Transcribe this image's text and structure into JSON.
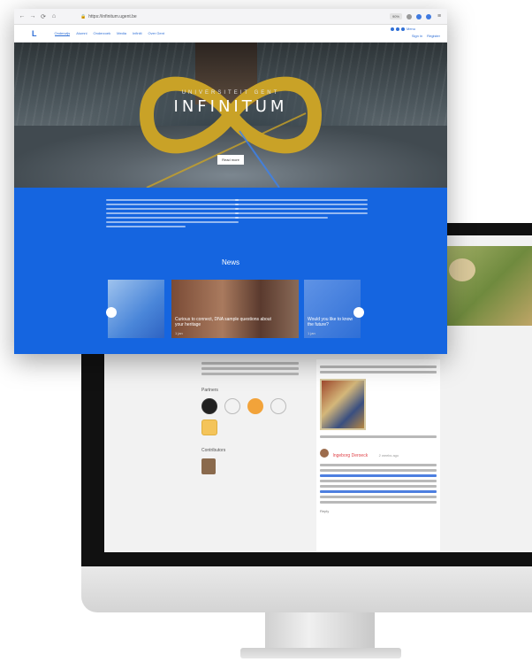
{
  "browser": {
    "url": "https://infinitum.ugent.be",
    "nav_back": "←",
    "nav_forward": "→",
    "nav_reload": "⟳",
    "nav_home": "⌂",
    "lock": "🔒",
    "zoom": "90%",
    "menu": "≡"
  },
  "site": {
    "brand": "L",
    "nav": [
      "Onderwijs",
      "Alumni",
      "Onderzoek",
      "Media",
      "Infiniti",
      "Over Gent"
    ],
    "auth_login": "Sign in",
    "auth_register": "Register",
    "tools_label": "Menu"
  },
  "hero": {
    "subtitle": "UNIVERSITEIT GENT",
    "title": "INFINITUM",
    "button": "Read more",
    "accent_color": "#c9a227"
  },
  "news": {
    "title": "News",
    "cards": [
      {
        "caption": "",
        "meta": ""
      },
      {
        "caption": "Curious to connect, DNA sample questions about your heritage",
        "meta": "1 jan"
      },
      {
        "caption": "Would you like to know the future?",
        "meta": "1 jan"
      }
    ]
  },
  "inner_page": {
    "section_label": "Partners",
    "contributors_label": "Contributors",
    "comment_author": "Ingeborg Deroeck",
    "comment_time": "2 weeks ago",
    "reply_label": "Reply"
  },
  "colors": {
    "blue": "#1565e0",
    "link": "#2f6fd6",
    "gold": "#c9a227"
  }
}
